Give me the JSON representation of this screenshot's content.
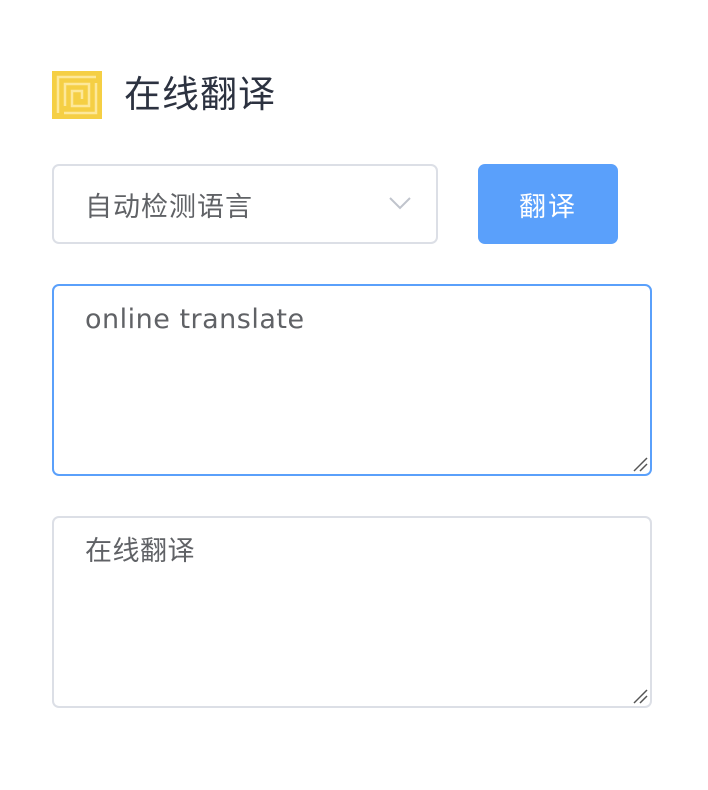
{
  "app": {
    "title": "在线翻译",
    "logo_icon": "logo-icon",
    "logo_color": "#f5cf44"
  },
  "controls": {
    "language_select": {
      "value": "自动检测语言",
      "icon": "chevron-down-icon"
    },
    "translate_button": {
      "label": "翻译",
      "color": "#5aa0fb"
    }
  },
  "source": {
    "text": "online translate",
    "focused_border_color": "#5aa0fb"
  },
  "result": {
    "text": "在线翻译"
  }
}
